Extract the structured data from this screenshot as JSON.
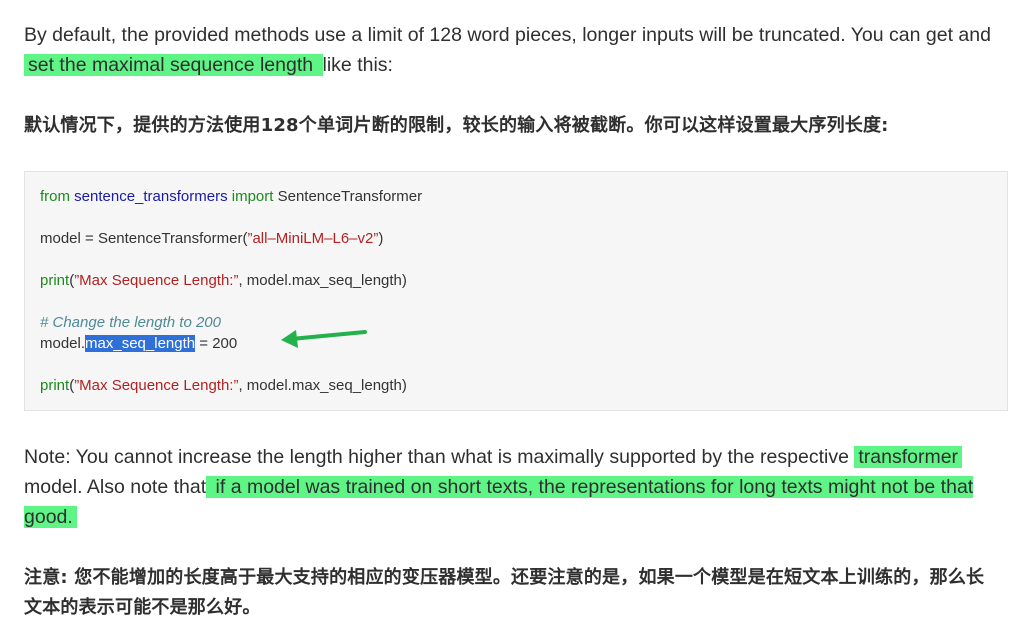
{
  "intro": {
    "text_before": "By default, the provided methods use a limit of 128 word pieces, longer inputs will be truncated. You can get and ",
    "highlight": "set the maximal sequence length ",
    "text_after": "like this:"
  },
  "intro_zh": "默认情况下，提供的方法使用128个单词片断的限制，较长的输入将被截断。你可以这样设置最大序列长度:",
  "code": {
    "line1": {
      "kw_from": "from",
      "module": "sentence_transformers",
      "kw_import": "import",
      "name": "SentenceTransformer"
    },
    "line2": {
      "prefix": "model = SentenceTransformer(",
      "string": "”all–MiniLM–L6–v2”",
      "suffix": ")"
    },
    "line3": {
      "func": "print",
      "open": "(",
      "string": "”Max Sequence Length:”",
      "rest": ", model.max_seq_length)"
    },
    "line4": {
      "comment": "# Change the length to 200"
    },
    "line5": {
      "obj": "model.",
      "attr": "max_seq_length",
      "rest": " = 200"
    },
    "line6": {
      "func": "print",
      "open": "(",
      "string": "”Max Sequence Length:”",
      "rest": ", model.max_seq_length)"
    }
  },
  "note": {
    "part1": "Note: You cannot increase the length higher than what is maximally supported by the respective ",
    "hl1": "transformer",
    "part2": " model. Also note that",
    "hl2": " if a model was trained on short texts, the representations for long texts might not be that good. "
  },
  "note_zh": "注意: 您不能增加的长度高于最大支持的相应的变压器模型。还要注意的是，如果一个模型是在短文本上训练的，那么长文本的表示可能不是那么好。",
  "colors": {
    "highlight": "#5ef486",
    "arrow": "#22b14c",
    "selection": "#2f6fd8",
    "code_background": "#f6f6f6"
  },
  "icons": {
    "annotation": "arrow-left-icon"
  }
}
